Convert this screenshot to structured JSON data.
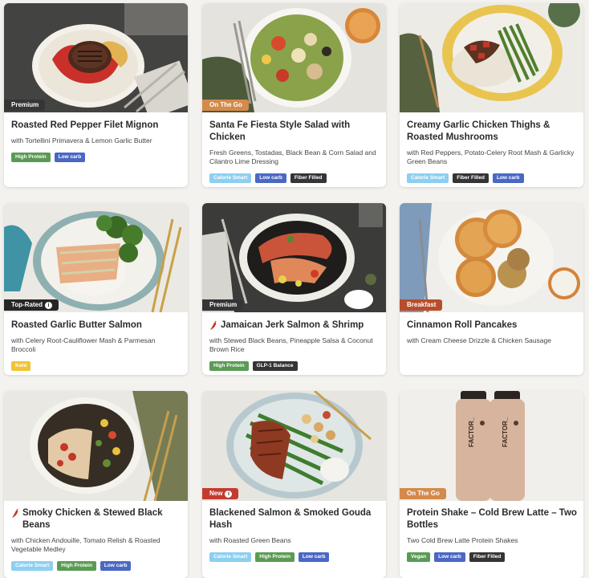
{
  "tag_colors": {
    "High Protein": "#5a9b54",
    "Low carb": "#4a68c4",
    "Calorie Smart": "#8dcff1",
    "Fiber Filled": "#353535",
    "Keto": "#f2c335",
    "GLP-1 Balance": "#353535",
    "Vegan": "#5a9b54"
  },
  "ribbon_colors": {
    "Premium": "#353535",
    "On The Go": "#d48a4a",
    "Top-Rated": "#262626",
    "Breakfast": "#b84d2c",
    "New": "#c43a2f"
  },
  "cards": [
    {
      "ribbon": "Premium",
      "ribbon_info": false,
      "spicy": false,
      "title": "Roasted Red Pepper Filet Mignon",
      "subtitle": "with Tortellini Primavera & Lemon Garlic Butter",
      "tags": [
        "High Protein",
        "Low carb"
      ]
    },
    {
      "ribbon": "On The Go",
      "ribbon_info": false,
      "spicy": false,
      "title": "Santa Fe Fiesta Style Salad with Chicken",
      "subtitle": "Fresh Greens, Tostadas, Black Bean & Corn Salad and Cilantro Lime Dressing",
      "tags": [
        "Calorie Smart",
        "Low carb",
        "Fiber Filled"
      ]
    },
    {
      "ribbon": "",
      "ribbon_info": false,
      "spicy": false,
      "title": "Creamy Garlic Chicken Thighs & Roasted Mushrooms",
      "subtitle": "with Red Peppers, Potato-Celery Root Mash & Garlicky Green Beans",
      "tags": [
        "Calorie Smart",
        "Fiber Filled",
        "Low carb"
      ]
    },
    {
      "ribbon": "Top-Rated",
      "ribbon_info": true,
      "spicy": false,
      "title": "Roasted Garlic Butter Salmon",
      "subtitle": "with Celery Root-Cauliflower Mash & Parmesan Broccoli",
      "tags": [
        "Keto"
      ]
    },
    {
      "ribbon": "Premium",
      "ribbon_info": false,
      "spicy": true,
      "title": "Jamaican Jerk Salmon & Shrimp",
      "subtitle": "with Stewed Black Beans, Pineapple Salsa & Coconut Brown Rice",
      "tags": [
        "High Protein",
        "GLP-1 Balance"
      ]
    },
    {
      "ribbon": "Breakfast",
      "ribbon_info": false,
      "spicy": false,
      "title": "Cinnamon Roll Pancakes",
      "subtitle": "with Cream Cheese Drizzle & Chicken Sausage",
      "tags": []
    },
    {
      "ribbon": "",
      "ribbon_info": false,
      "spicy": true,
      "title": "Smoky Chicken & Stewed Black Beans",
      "subtitle": "with Chicken Andouille, Tomato Relish & Roasted Vegetable Medley",
      "tags": [
        "Calorie Smart",
        "High Protein",
        "Low carb"
      ]
    },
    {
      "ribbon": "New",
      "ribbon_info": true,
      "spicy": false,
      "title": "Blackened Salmon & Smoked Gouda Hash",
      "subtitle": "with Roasted Green Beans",
      "tags": [
        "Calorie Smart",
        "High Protein",
        "Low carb"
      ]
    },
    {
      "ribbon": "On The Go",
      "ribbon_info": false,
      "spicy": false,
      "title": "Protein Shake – Cold Brew Latte – Two Bottles",
      "subtitle": "Two Cold Brew Latte Protein Shakes",
      "tags": [
        "Vegan",
        "Low carb",
        "Fiber Filled"
      ],
      "bottle_label": "FACTOR_"
    }
  ]
}
